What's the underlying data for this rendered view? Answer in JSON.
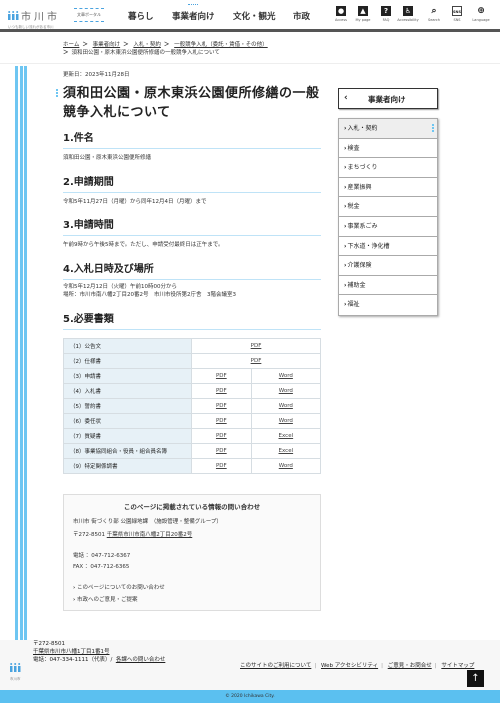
{
  "header": {
    "logo_name": "市川市",
    "logo_tagline": "いつも新しい流れがある市川",
    "portal_label": "文章ポータル",
    "nav": [
      {
        "label": "暮らし",
        "current": false
      },
      {
        "label": "事業者向け",
        "current": true
      },
      {
        "label": "文化・観光",
        "current": false
      },
      {
        "label": "市政",
        "current": false
      }
    ],
    "tools": [
      {
        "icon": "map-pin-icon",
        "label": "Access"
      },
      {
        "icon": "user-icon",
        "label": "My page"
      },
      {
        "icon": "question-icon",
        "label": "FAQ"
      },
      {
        "icon": "accessibility-icon",
        "label": "Accessibility"
      },
      {
        "icon": "search-icon",
        "label": "Search"
      },
      {
        "icon": "sns-icon",
        "label": "SNS"
      },
      {
        "icon": "globe-icon",
        "label": "Language"
      }
    ]
  },
  "breadcrumb": {
    "items": [
      "ホーム",
      "事業者向け",
      "入札・契約",
      "一般競争入札（委託・賃借・その他）"
    ],
    "current": "須和田公園・原木東浜公園便所修繕の一般競争入札について"
  },
  "page": {
    "updated": "更新日：2023年11月28日",
    "title": "須和田公園・原木東浜公園便所修繕の一般競争入札について",
    "sections": [
      {
        "heading": "1.件名",
        "lines": [
          "須和田公園・原木東浜公園便所修繕"
        ]
      },
      {
        "heading": "2.申請期間",
        "lines": [
          "令和5年11月27日（月曜）から同年12月4日（月曜）まで"
        ]
      },
      {
        "heading": "3.申請時間",
        "lines": [
          "午前9時から午後5時まで。ただし、申請受付最終日は正午まで。"
        ]
      },
      {
        "heading": "4.入札日時及び場所",
        "lines": [
          "令和5年12月12日（火曜）午前10時00分から",
          "場所：市川市南八幡2丁目20番2号　市川市役所第2庁舎　3階会議室3"
        ]
      },
      {
        "heading": "5.必要書類",
        "lines": []
      }
    ],
    "documents": [
      {
        "name": "（1）公告文",
        "links": [
          "PDF"
        ]
      },
      {
        "name": "（2）仕様書",
        "links": [
          "PDF"
        ]
      },
      {
        "name": "（3）申請書",
        "links": [
          "PDF",
          "Word"
        ]
      },
      {
        "name": "（4）入札書",
        "links": [
          "PDF",
          "Word"
        ]
      },
      {
        "name": "（5）誓約書",
        "links": [
          "PDF",
          "Word"
        ]
      },
      {
        "name": "（6）委任状",
        "links": [
          "PDF",
          "Word"
        ]
      },
      {
        "name": "（7）質疑書",
        "links": [
          "PDF",
          "Excel"
        ]
      },
      {
        "name": "（8）事業協同組合・役員・組合員名簿",
        "links": [
          "PDF",
          "Excel"
        ]
      },
      {
        "name": "（9）特定関係調書",
        "links": [
          "PDF",
          "Word"
        ]
      }
    ]
  },
  "contact": {
    "title": "このページに掲載されている情報の問い合わせ",
    "dept": "市川市 街づくり部 公園緑地課　（施設管理・整備グループ）",
    "postal": "〒272-8501",
    "address": "千葉県市川市南八幡2丁目20番2号",
    "tel": "電話 ：047-712-6367",
    "fax": "FAX ：047-712-6365",
    "link1": "このページについてのお問い合わせ",
    "link2": "市政へのご意見・ご提案"
  },
  "sidebar": {
    "back_label": "事業者向け",
    "items": [
      {
        "label": "入札・契約",
        "active": true
      },
      {
        "label": "検査",
        "active": false
      },
      {
        "label": "まちづくり",
        "active": false
      },
      {
        "label": "産業振興",
        "active": false
      },
      {
        "label": "税金",
        "active": false
      },
      {
        "label": "事業系ごみ",
        "active": false
      },
      {
        "label": "下水道・浄化槽",
        "active": false
      },
      {
        "label": "介護保険",
        "active": false
      },
      {
        "label": "補助金",
        "active": false
      },
      {
        "label": "福祉",
        "active": false
      }
    ]
  },
  "footer": {
    "logo_caption": "市川市",
    "postal": "〒272-8501",
    "address": "千葉県市川市八幡1丁目1番1号",
    "tel": "電話：047-334-1111（代表）/",
    "contact_link": "各課への問い合わせ",
    "links": [
      "このサイトのご利用について",
      "Web アクセシビリティ",
      "ご意見・お問合せ",
      "サイトマップ"
    ],
    "copyright": "© 2020 Ichikawa City.",
    "to_top": "↑"
  },
  "colors": {
    "accent": "#6ec6f2",
    "footer_bar": "#5bc0f0",
    "table_header": "#e7f1f7"
  }
}
